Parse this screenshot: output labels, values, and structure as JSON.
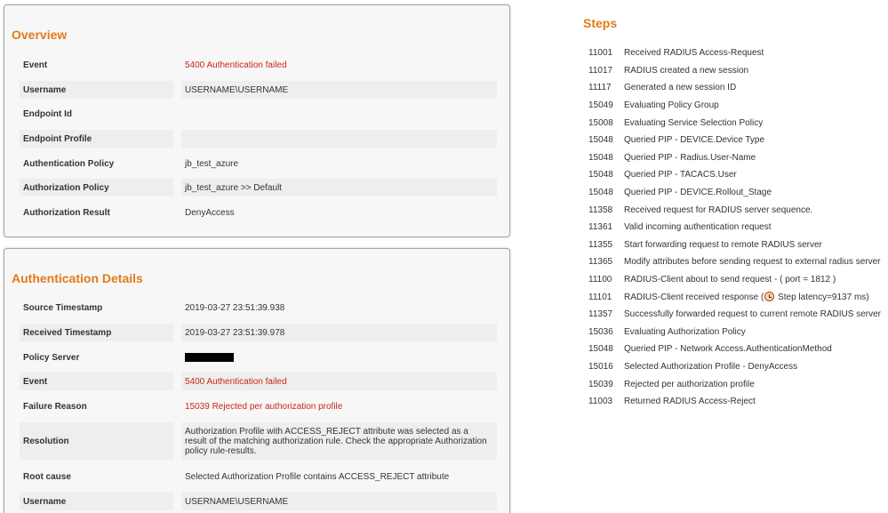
{
  "overview": {
    "title": "Overview",
    "rows": [
      {
        "label": "Event",
        "value": "5400 Authentication failed"
      },
      {
        "label": "Username",
        "value": "USERNAME\\USERNAME"
      },
      {
        "label": "Endpoint Id",
        "value": ""
      },
      {
        "label": "Endpoint Profile",
        "value": ""
      },
      {
        "label": "Authentication Policy",
        "value": "jb_test_azure"
      },
      {
        "label": "Authorization Policy",
        "value": "jb_test_azure >> Default"
      },
      {
        "label": "Authorization Result",
        "value": "DenyAccess"
      }
    ]
  },
  "auth_details": {
    "title": "Authentication Details",
    "rows": [
      {
        "label": "Source Timestamp",
        "value": "2019-03-27 23:51:39.938"
      },
      {
        "label": "Received Timestamp",
        "value": "2019-03-27 23:51:39.978"
      },
      {
        "label": "Policy Server",
        "value": ""
      },
      {
        "label": "Event",
        "value": "5400 Authentication failed"
      },
      {
        "label": "Failure Reason",
        "value": "15039 Rejected per authorization profile"
      },
      {
        "label": "Resolution",
        "value": "Authorization Profile with ACCESS_REJECT attribute was selected as a result of the matching authorization rule. Check the appropriate Authorization policy rule-results."
      },
      {
        "label": "Root cause",
        "value": "Selected Authorization Profile contains ACCESS_REJECT attribute"
      },
      {
        "label": "Username",
        "value": "USERNAME\\USERNAME"
      }
    ]
  },
  "steps": {
    "title": "Steps",
    "items": [
      {
        "code": "11001",
        "desc": "Received RADIUS Access-Request"
      },
      {
        "code": "11017",
        "desc": "RADIUS created a new session"
      },
      {
        "code": "11117",
        "desc": "Generated a new session ID"
      },
      {
        "code": "15049",
        "desc": "Evaluating Policy Group"
      },
      {
        "code": "15008",
        "desc": "Evaluating Service Selection Policy"
      },
      {
        "code": "15048",
        "desc": "Queried PIP - DEVICE.Device Type"
      },
      {
        "code": "15048",
        "desc": "Queried PIP - Radius.User-Name"
      },
      {
        "code": "15048",
        "desc": "Queried PIP - TACACS.User"
      },
      {
        "code": "15048",
        "desc": "Queried PIP - DEVICE.Rollout_Stage"
      },
      {
        "code": "11358",
        "desc": "Received request for RADIUS server sequence."
      },
      {
        "code": "11361",
        "desc": "Valid incoming authentication request"
      },
      {
        "code": "11355",
        "desc": "Start forwarding request to remote RADIUS server"
      },
      {
        "code": "11365",
        "desc": "Modify attributes before sending request to external radius server"
      },
      {
        "code": "11100",
        "desc": "RADIUS-Client about to send request - ( port = 1812 )"
      },
      {
        "code": "11101",
        "desc": "RADIUS-Client received response (",
        "desc_after": " Step latency=9137 ms)"
      },
      {
        "code": "11357",
        "desc": "Successfully forwarded request to current remote RADIUS server"
      },
      {
        "code": "15036",
        "desc": "Evaluating Authorization Policy"
      },
      {
        "code": "15048",
        "desc": "Queried PIP - Network Access.AuthenticationMethod"
      },
      {
        "code": "15016",
        "desc": "Selected Authorization Profile - DenyAccess"
      },
      {
        "code": "15039",
        "desc": "Rejected per authorization profile"
      },
      {
        "code": "11003",
        "desc": "Returned RADIUS Access-Reject"
      }
    ]
  },
  "colors": {
    "accent": "#e07b18",
    "error": "#c8261c",
    "shade": "#eeeeee"
  },
  "icons": {
    "latency": "alarm-clock-icon"
  }
}
